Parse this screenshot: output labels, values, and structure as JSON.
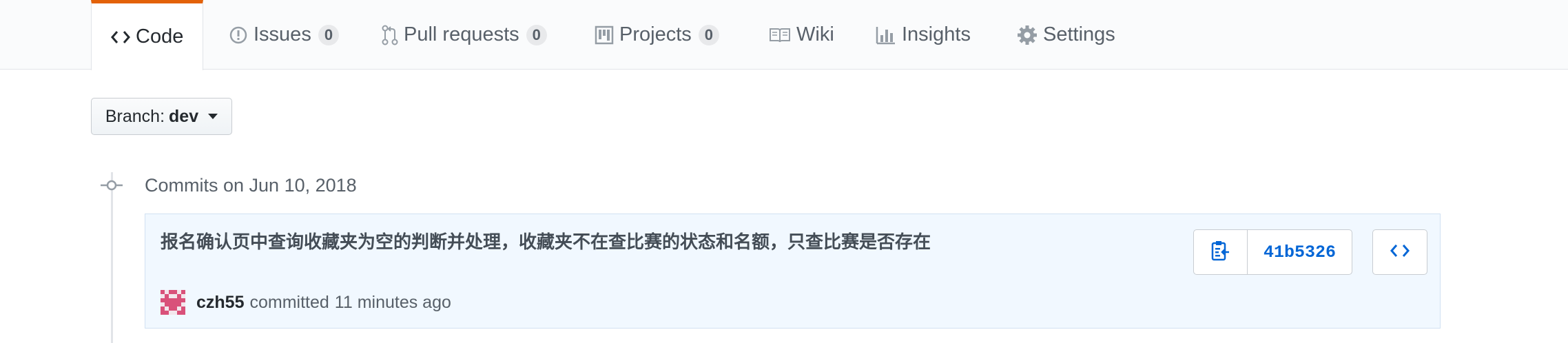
{
  "nav": {
    "tabs": [
      {
        "label": "Code",
        "icon": "code-icon",
        "selected": true
      },
      {
        "label": "Issues",
        "icon": "issue-opened-icon",
        "count": "0"
      },
      {
        "label": "Pull requests",
        "icon": "git-pull-request-icon",
        "count": "0"
      },
      {
        "label": "Projects",
        "icon": "project-icon",
        "count": "0"
      },
      {
        "label": "Wiki",
        "icon": "book-icon"
      },
      {
        "label": "Insights",
        "icon": "graph-icon"
      },
      {
        "label": "Settings",
        "icon": "gear-icon"
      }
    ],
    "accent_color": "#e36209"
  },
  "branch": {
    "prefix": "Branch:",
    "name": "dev"
  },
  "commits_group": {
    "heading": "Commits on Jun 10, 2018",
    "commits": [
      {
        "title": "报名确认页中查询收藏夹为空的判断并处理，收藏夹不在查比赛的状态和名额，只查比赛是否存在",
        "author": "czh55",
        "action": "committed",
        "time": "11 minutes ago",
        "sha": "41b5326"
      }
    ]
  },
  "colors": {
    "link": "#0366d6",
    "commit_bg": "#f1f8ff",
    "avatar": "#d9517a"
  }
}
